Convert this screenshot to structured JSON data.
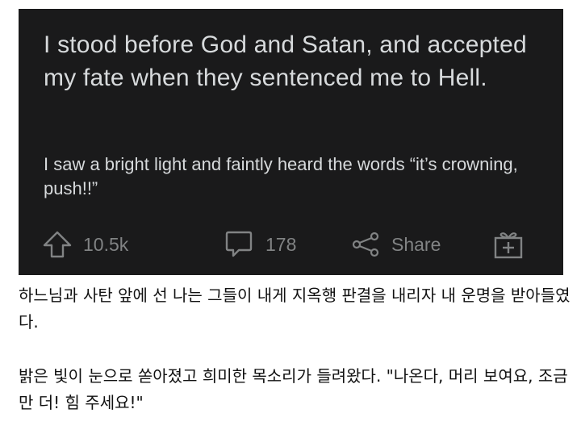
{
  "post": {
    "title": "I stood before God and Satan, and accepted my fate when they sentenced me to Hell.",
    "body": "I saw a bright light and faintly heard the words “it’s crowning, push!!”",
    "upvotes": "10.5k",
    "comments": "178",
    "share_label": "Share"
  },
  "translation": {
    "title_ko": "하느님과 사탄 앞에 선 나는 그들이 내게 지옥행 판결을 내리자 내 운명을 받아들였다.",
    "body_ko": "밝은 빛이 눈으로 쏟아졌고 희미한 목소리가 들려왔다. \"나온다, 머리 보여요, 조금만 더! 힘 주세요!\""
  },
  "colors": {
    "card_background": "#1a1a1b",
    "card_text": "#d7dadc",
    "action_text": "#818384",
    "page_background": "#ffffff",
    "page_text": "#111111"
  },
  "icons": [
    "upvote-arrow-icon",
    "comment-bubble-icon",
    "share-icon",
    "gift-award-icon"
  ]
}
